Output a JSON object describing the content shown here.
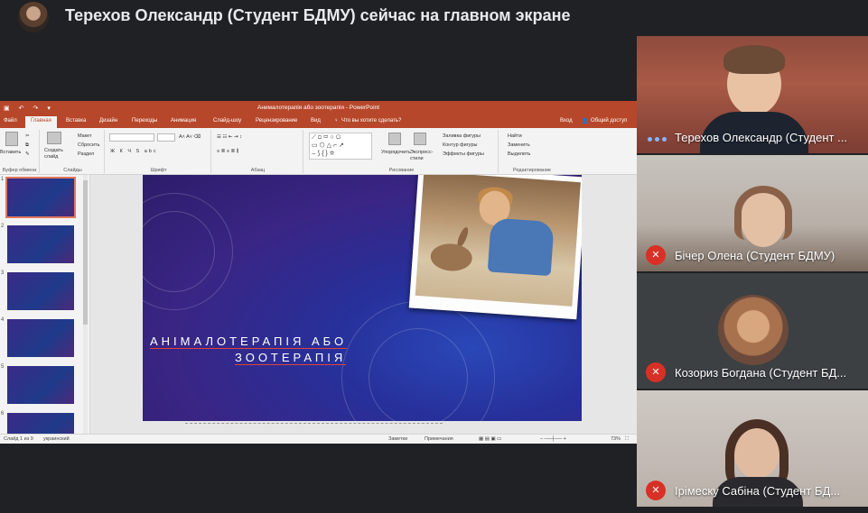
{
  "presenter_banner": {
    "text": "Терехов Олександр (Студент БДМУ) сейчас на главном экране"
  },
  "ppt": {
    "window_title": "Анималотерапія або зоотерапія - PowerPoint",
    "quick_access": [
      "↶",
      "↷",
      "▾"
    ],
    "tabs": [
      "Файл",
      "Главная",
      "Вставка",
      "Дизайн",
      "Переходы",
      "Анимация",
      "Слайд-шоу",
      "Рецензирование",
      "Вид"
    ],
    "tell_me": "Что вы хотите сделать?",
    "signin": "Вход",
    "share": "Общий доступ",
    "ribbon": {
      "clipboard_label": "Буфер обмена",
      "paste": "Вставить",
      "slides_label": "Слайды",
      "new_slide": "Создать слайд",
      "layout": "Макет",
      "reset": "Сбросить",
      "section": "Раздел",
      "font_label": "Шрифт",
      "font_format": "Ж К Ч S abc",
      "paragraph_label": "Абзац",
      "drawing_label": "Рисование",
      "arrange": "Упорядочить",
      "quick_styles": "Экспресс-стили",
      "shape_fill": "Заливка фигуры",
      "shape_outline": "Контур фигуры",
      "shape_effects": "Эффекты фигуры",
      "editing_label": "Редактирование",
      "find": "Найти",
      "replace": "Заменить",
      "select": "Выделить"
    },
    "thumb_numbers": [
      "1",
      "2",
      "3",
      "4",
      "5",
      "6"
    ],
    "slide": {
      "title_line1": "АНІМАЛОТЕРАПІЯ АБО",
      "title_line2": "ЗООТЕРАПІЯ"
    },
    "status": {
      "slide_count": "Слайд 1 из 9",
      "language": "украинский",
      "notes": "Заметки",
      "comments": "Примечания",
      "zoom": "73%"
    }
  },
  "participants": [
    {
      "name": "Терехов Олександр (Студент ...",
      "mic_muted": false
    },
    {
      "name": "Бічер Олена (Студент БДМУ)",
      "mic_muted": true
    },
    {
      "name": "Козориз Богдана (Студент БД...",
      "mic_muted": true
    },
    {
      "name": "Ірімеску Сабіна (Студент БД...",
      "mic_muted": true
    }
  ],
  "colors": {
    "meet_bg": "#202124",
    "ppt_accent": "#b7472a",
    "mic_muted": "#d93025",
    "speaking_dots": "#8ab4f8"
  },
  "icons": {
    "mic_off": "mic-off-icon",
    "speaking": "speaking-dots-icon"
  }
}
